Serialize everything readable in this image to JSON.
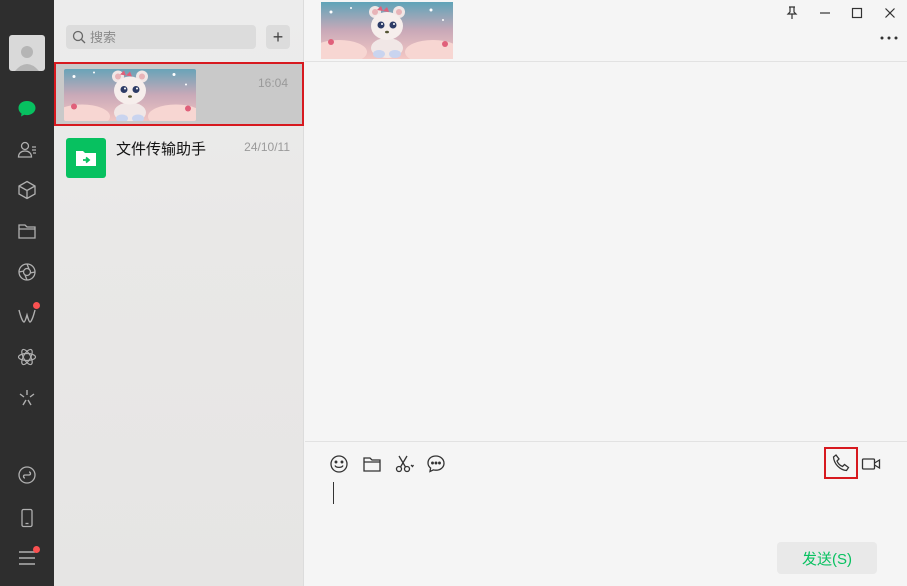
{
  "sidebar": {
    "nav": [
      "avatar",
      "chat-icon",
      "contacts-icon",
      "favorites-icon",
      "folder-icon",
      "moments-icon",
      "channels-icon",
      "mini-programs-icon",
      "search-feature-icon",
      "mini-program-link-icon",
      "phone-icon",
      "menu-icon"
    ]
  },
  "list": {
    "search_placeholder": "搜索",
    "add_label": "+",
    "chats": [
      {
        "name": "",
        "time": "16:04",
        "thumbnail": "bear-banner-image"
      },
      {
        "name": "文件传输助手",
        "time": "24/10/11",
        "icon": "file-transfer-icon"
      }
    ]
  },
  "window": {
    "buttons": [
      "pin-icon",
      "minimize-icon",
      "maximize-icon",
      "close-icon"
    ]
  },
  "composer": {
    "tools": [
      "emoji-icon",
      "folder-icon",
      "scissors-icon",
      "chat-history-icon"
    ],
    "call_tools": [
      "voice-call-icon",
      "video-call-icon"
    ],
    "send_label": "发送(S)"
  },
  "colors": {
    "accent": "#07c160",
    "rail": "#2e2e2e",
    "highlight_border": "#d7191f",
    "badge": "#fa5151"
  }
}
